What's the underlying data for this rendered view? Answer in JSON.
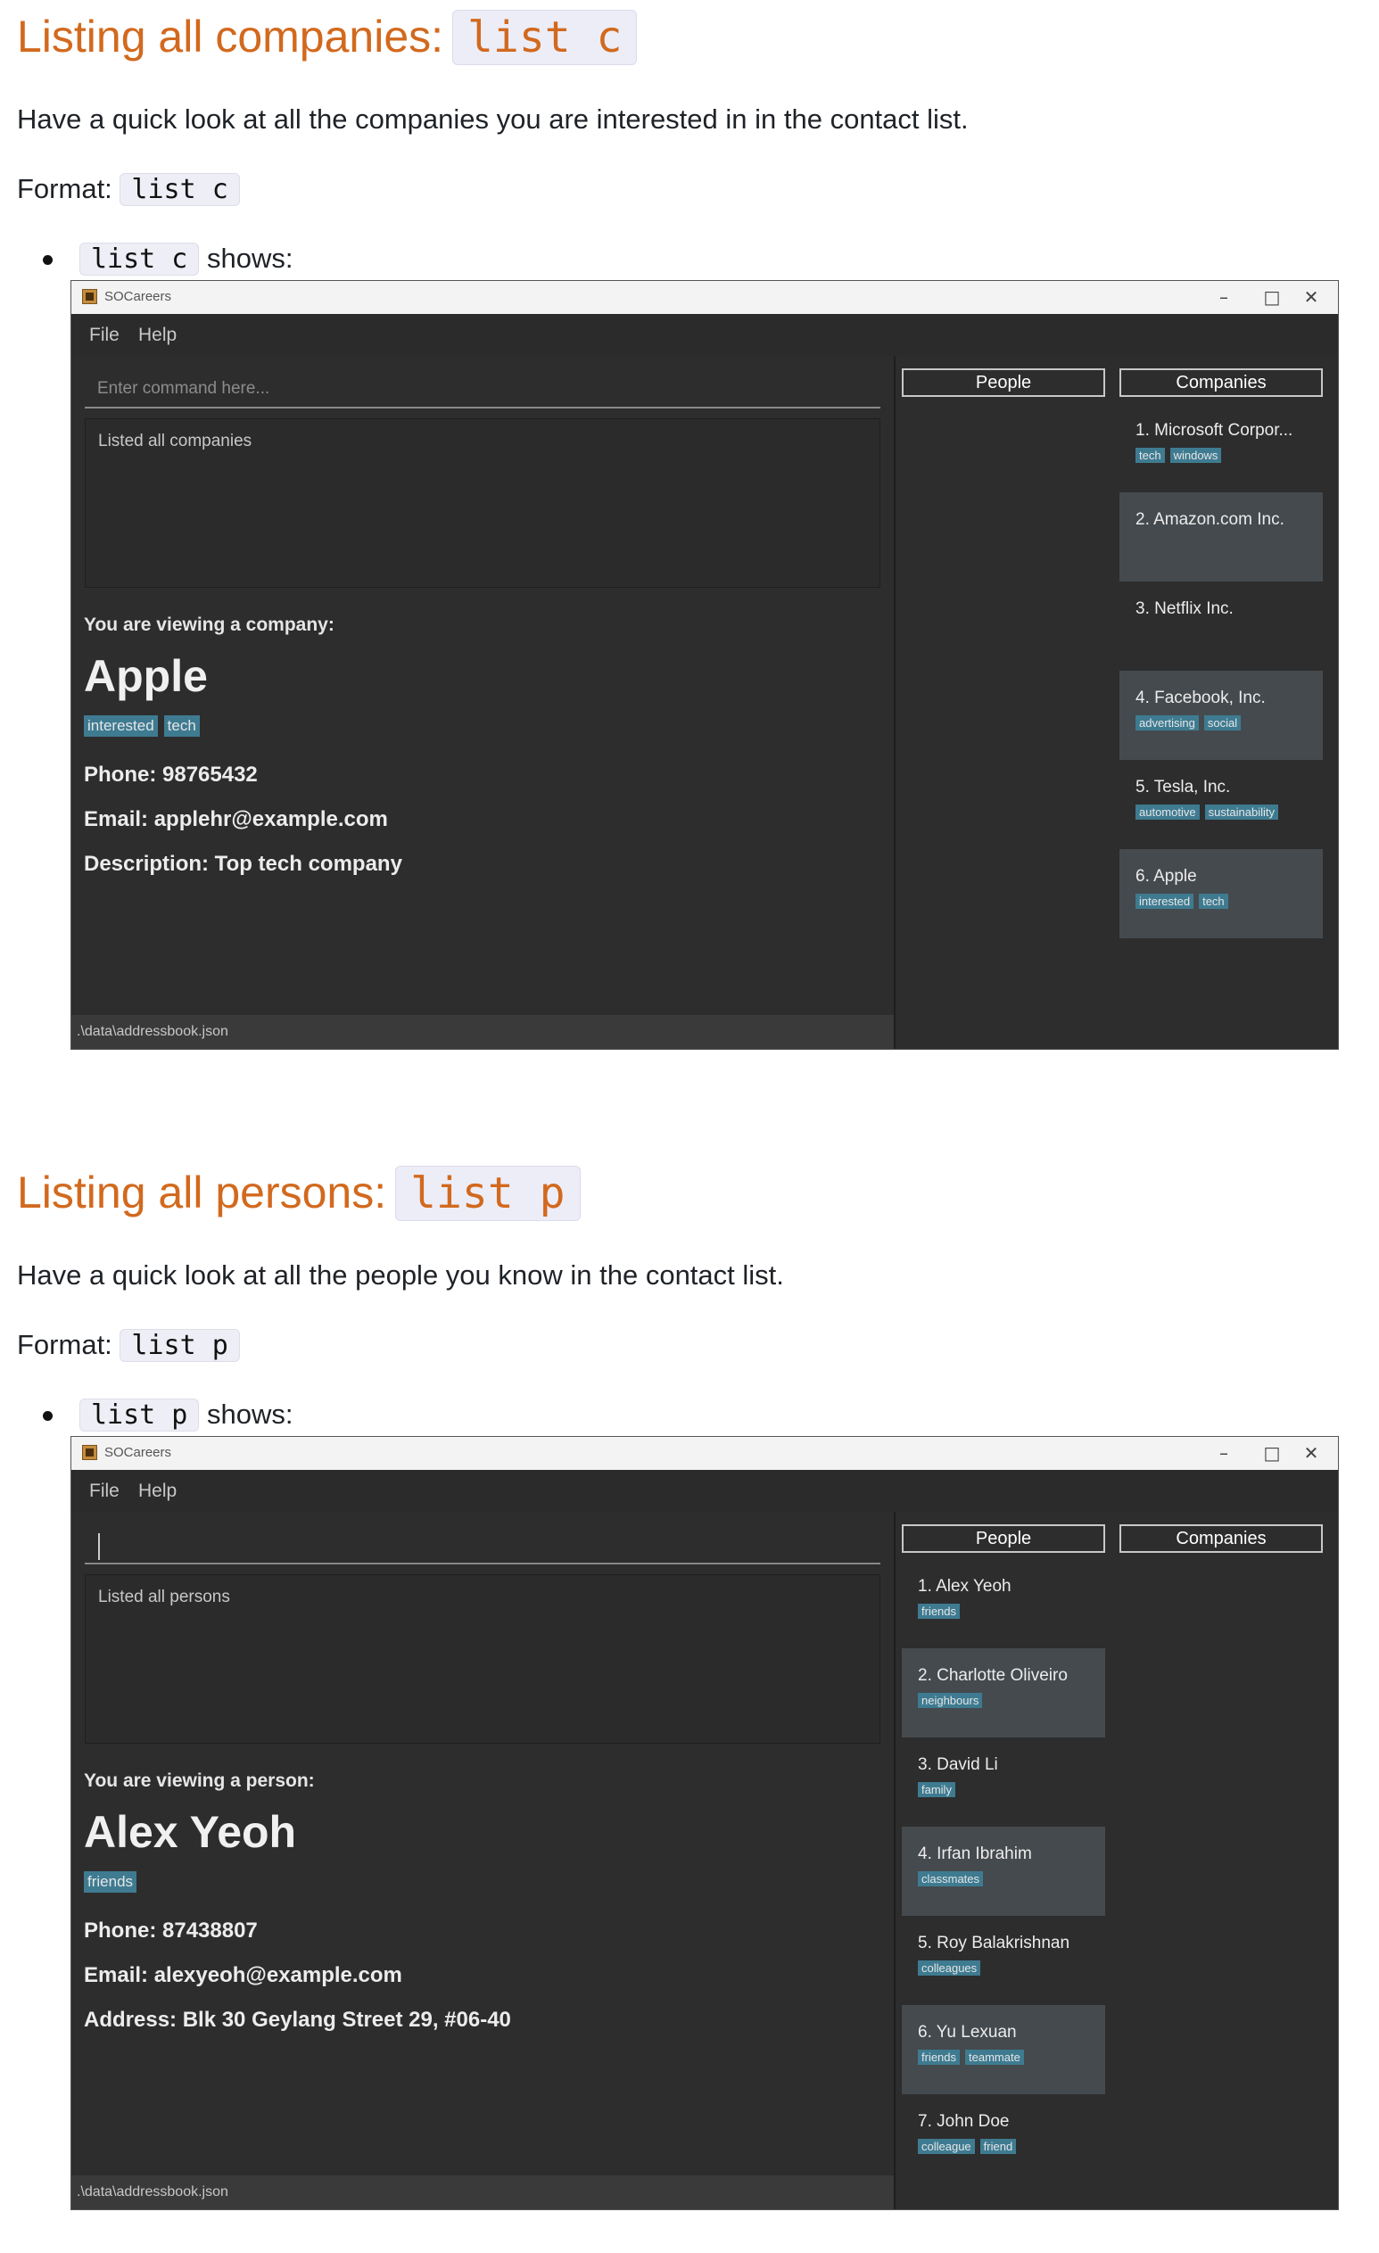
{
  "section1": {
    "heading": "Listing all companies:",
    "heading_code": "list c",
    "description": "Have a quick look at all the companies you are interested in in the contact list.",
    "format_label": "Format:",
    "format_code": "list c",
    "bullet_code": "list c",
    "bullet_text": "shows:",
    "app": {
      "title": "SOCareers",
      "menu": [
        "File",
        "Help"
      ],
      "command_placeholder": "Enter command here...",
      "result": "Listed all companies",
      "detail": {
        "header": "You are viewing a company:",
        "name": "Apple",
        "tags": [
          "interested",
          "tech"
        ],
        "lines": [
          "Phone: 98765432",
          "Email: applehr@example.com",
          "Description: Top tech company"
        ]
      },
      "status": ".\\data\\addressbook.json",
      "people_label": "People",
      "companies_label": "Companies",
      "companies": [
        {
          "name": "1.  Microsoft Corpor...",
          "tags": [
            "tech",
            "windows"
          ]
        },
        {
          "name": "2.  Amazon.com Inc.",
          "tags": []
        },
        {
          "name": "3.  Netflix Inc.",
          "tags": []
        },
        {
          "name": "4.  Facebook, Inc.",
          "tags": [
            "advertising",
            "social"
          ]
        },
        {
          "name": "5.  Tesla, Inc.",
          "tags": [
            "automotive",
            "sustainability"
          ]
        },
        {
          "name": "6.  Apple",
          "tags": [
            "interested",
            "tech"
          ]
        }
      ]
    }
  },
  "section2": {
    "heading": "Listing all persons:",
    "heading_code": "list p",
    "description": "Have a quick look at all the people you know in the contact list.",
    "format_label": "Format:",
    "format_code": "list p",
    "bullet_code": "list p",
    "bullet_text": "shows:",
    "app": {
      "title": "SOCareers",
      "menu": [
        "File",
        "Help"
      ],
      "result": "Listed all persons",
      "detail": {
        "header": "You are viewing a person:",
        "name": "Alex Yeoh",
        "tags": [
          "friends"
        ],
        "lines": [
          "Phone: 87438807",
          "Email: alexyeoh@example.com",
          "Address: Blk 30 Geylang Street 29, #06-40"
        ]
      },
      "status": ".\\data\\addressbook.json",
      "people_label": "People",
      "companies_label": "Companies",
      "people": [
        {
          "name": "1.  Alex Yeoh",
          "tags": [
            "friends"
          ]
        },
        {
          "name": "2.  Charlotte Oliveiro",
          "tags": [
            "neighbours"
          ]
        },
        {
          "name": "3.  David Li",
          "tags": [
            "family"
          ]
        },
        {
          "name": "4.  Irfan Ibrahim",
          "tags": [
            "classmates"
          ]
        },
        {
          "name": "5.  Roy Balakrishnan",
          "tags": [
            "colleagues"
          ]
        },
        {
          "name": "6.  Yu Lexuan",
          "tags": [
            "friends",
            "teammate"
          ]
        },
        {
          "name": "7.  John Doe",
          "tags": [
            "colleague",
            "friend"
          ]
        }
      ]
    }
  }
}
